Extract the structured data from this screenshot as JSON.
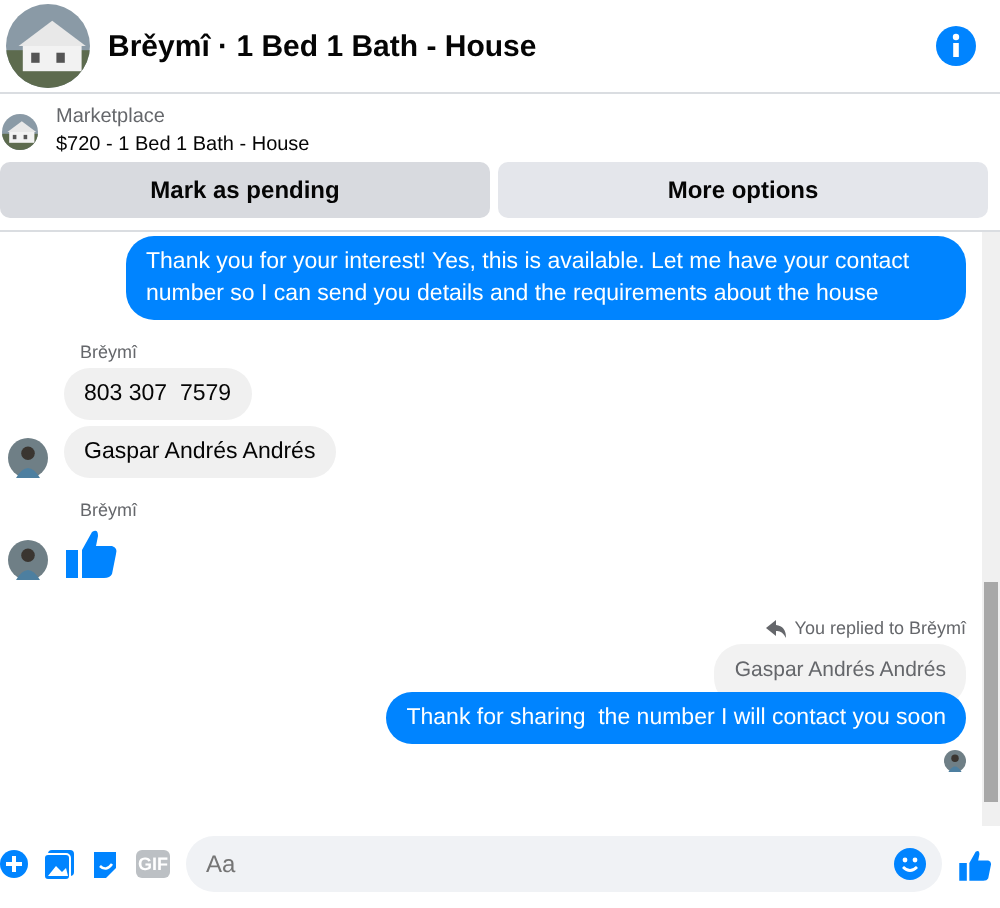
{
  "header": {
    "title": "Brěymî · 1 Bed 1 Bath - House"
  },
  "listing": {
    "source": "Marketplace",
    "summary": "$720 - 1 Bed 1 Bath - House"
  },
  "actions": [
    {
      "label": "Mark as pending",
      "selected": true
    },
    {
      "label": "More options",
      "selected": false
    }
  ],
  "messages": [
    {
      "kind": "sent",
      "text": "Thank you for your interest! Yes, this is available. Let me have your contact number so I can send you details and the requirements about the house"
    },
    {
      "kind": "sender",
      "text": "Brěymî"
    },
    {
      "kind": "received",
      "text": "803 307  7579",
      "avatar": false
    },
    {
      "kind": "received",
      "text": "Gaspar Andrés Andrés",
      "avatar": true
    },
    {
      "kind": "sender",
      "text": "Brěymî"
    },
    {
      "kind": "like",
      "avatar": true
    },
    {
      "kind": "reply-note",
      "text": "You replied to Brěymî"
    },
    {
      "kind": "quoted",
      "text": "Gaspar Andrés Andrés"
    },
    {
      "kind": "sent",
      "text": "Thank for sharing  the number I will contact you soon"
    },
    {
      "kind": "seen"
    }
  ],
  "composer": {
    "gif": "GIF",
    "placeholder": "Aa"
  }
}
